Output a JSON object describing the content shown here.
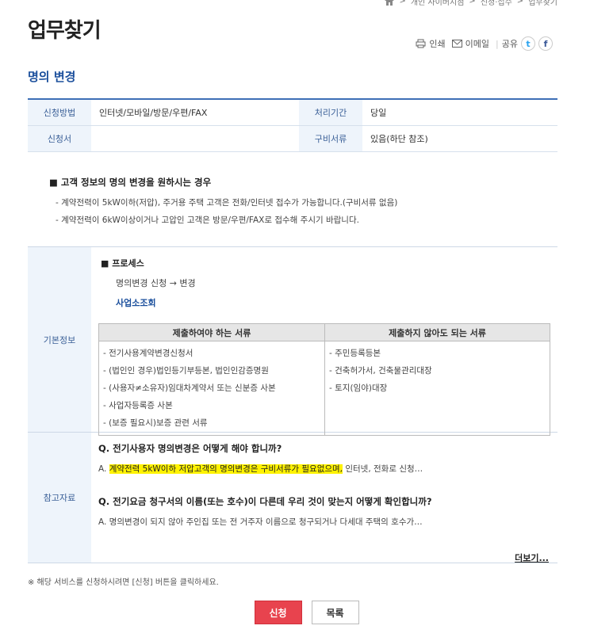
{
  "breadcrumb": [
    "개인 사이버지점",
    "신청·접수",
    "업무찾기"
  ],
  "page_title": "업무찾기",
  "util": {
    "print": "인쇄",
    "email": "이메일",
    "share": "공유",
    "twitter": "t",
    "facebook": "f"
  },
  "section_title": "명의 변경",
  "info": {
    "method_label": "신청방법",
    "method_value": "인터넷/모바일/방문/우편/FAX",
    "period_label": "처리기간",
    "period_value": "당일",
    "form_label": "신청서",
    "form_value": "",
    "docs_label": "구비서류",
    "docs_value": "있음(하단 참조)"
  },
  "notice": {
    "head": "■ 고객 정보의 명의 변경을 원하시는 경우",
    "lines": [
      "- 계약전력이 5kW이하(저압), 주거용 주택 고객은 전화/인터넷 접수가 가능합니다.(구비서류 없음)",
      "- 계약전력이 6kW이상이거나 고압인 고객은 방문/우편/FAX로 접수해 주시기 바랍니다."
    ]
  },
  "basic": {
    "label": "기본정보",
    "process_title": "■ 프로세스",
    "process_text": "명의변경 신청 → 변경",
    "process_link": "사업소조회",
    "required_header": "제출하여야 하는 서류",
    "optional_header": "제출하지 않아도 되는 서류",
    "required_docs": [
      "- 전기사용계약변경신청서",
      "- (법인인 경우)법인등기부등본, 법인인감증명원",
      "- (사용자≠소유자)임대차계약서 또는 신분증 사본",
      "- 사업자등록증 사본",
      "- (보증 필요시)보증 관련 서류"
    ],
    "optional_docs": [
      "- 주민등록등본",
      "- 건축허가서, 건축물관리대장",
      "- 토지(임야)대장"
    ]
  },
  "reference": {
    "label": "참고자료",
    "q1": "Q. 전기사용자 명의변경은 어떻게 해야 합니까?",
    "a1_prefix": "A. ",
    "a1_highlight": "계약전력 5kW이하 저압고객의 명의변경은 구비서류가 필요없으며,",
    "a1_rest": " 인터넷, 전화로 신청…",
    "q2": "Q. 전기요금 청구서의 이름(또는 호수)이 다른데 우리 것이 맞는지 어떻게 확인합니까?",
    "a2": "A. 명의변경이 되지 않아 주인집 또는 전 거주자 이름으로 청구되거나 다세대 주택의 호수가…",
    "more": "더보기..."
  },
  "footnote": "※ 해당 서비스를 신청하시려면 [신청] 버튼을 클릭하세요.",
  "buttons": {
    "apply": "신청",
    "list": "목록"
  }
}
